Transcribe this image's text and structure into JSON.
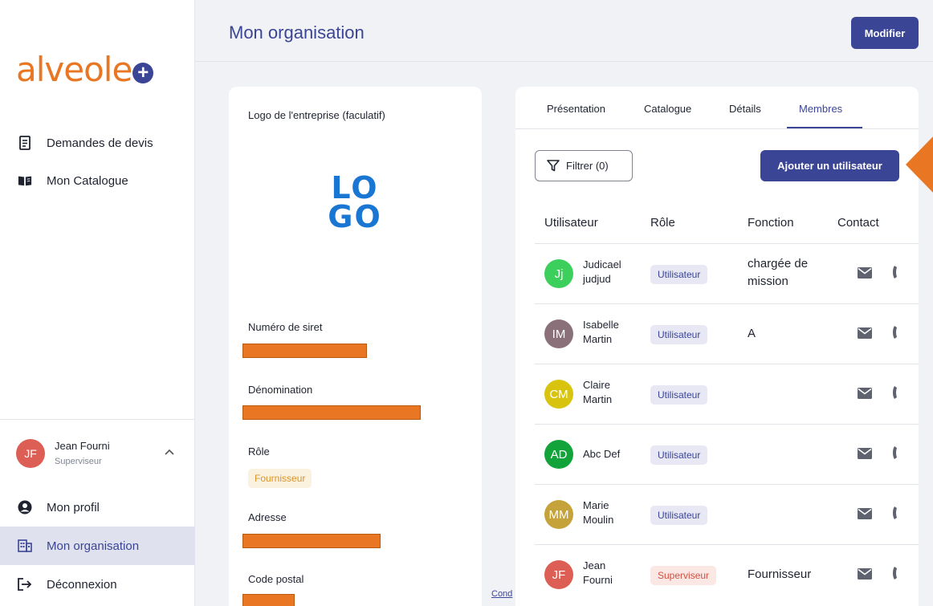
{
  "brand": {
    "logo_text": "alveole",
    "logo_plus": "+"
  },
  "sidebar": {
    "items": [
      {
        "label": "Demandes de devis",
        "icon": "document-list-icon"
      },
      {
        "label": "Mon Catalogue",
        "icon": "book-icon"
      }
    ],
    "user": {
      "initials": "JF",
      "name": "Jean Fourni",
      "role": "Superviseur"
    },
    "bottom_items": [
      {
        "label": "Mon profil",
        "icon": "account-circle-icon"
      },
      {
        "label": "Mon organisation",
        "icon": "building-icon",
        "active": true
      },
      {
        "label": "Déconnexion",
        "icon": "logout-icon"
      }
    ]
  },
  "header": {
    "title": "Mon organisation",
    "modify_label": "Modifier"
  },
  "org": {
    "logo_label": "Logo de l'entreprise (faculatif)",
    "logo_image_text": [
      "LO",
      "GO"
    ],
    "siret_label": "Numéro de siret",
    "denomination_label": "Dénomination",
    "role_label": "Rôle",
    "role_value": "Fournisseur",
    "adresse_label": "Adresse",
    "code_postal_label": "Code postal"
  },
  "footer": {
    "link_text": "Cond"
  },
  "tabs": [
    {
      "label": "Présentation"
    },
    {
      "label": "Catalogue"
    },
    {
      "label": "Détails"
    },
    {
      "label": "Membres",
      "active": true
    }
  ],
  "members": {
    "filter_label": "Filtrer (0)",
    "add_label": "Ajouter un utilisateur",
    "columns": [
      "Utilisateur",
      "Rôle",
      "Fonction",
      "Contact"
    ],
    "rows": [
      {
        "initials": "Jj",
        "first": "Judicael",
        "last": "judjud",
        "role": "Utilisateur",
        "fonction": [
          "chargée de",
          "mission"
        ],
        "color": "#3ccf5c"
      },
      {
        "initials": "IM",
        "first": "Isabelle",
        "last": "Martin",
        "role": "Utilisateur",
        "fonction": [
          "A",
          ""
        ],
        "color": "#8a7078"
      },
      {
        "initials": "CM",
        "first": "Claire",
        "last": "Martin",
        "role": "Utilisateur",
        "fonction": [
          "",
          ""
        ],
        "color": "#d8c40f"
      },
      {
        "initials": "AD",
        "first": "Abc Def",
        "last": "",
        "role": "Utilisateur",
        "fonction": [
          "",
          ""
        ],
        "color": "#12a33b"
      },
      {
        "initials": "MM",
        "first": "Marie",
        "last": "Moulin",
        "role": "Utilisateur",
        "fonction": [
          "",
          ""
        ],
        "color": "#c6a23a"
      },
      {
        "initials": "JF",
        "first": "Jean",
        "last": "Fourni",
        "role": "Superviseur",
        "fonction": [
          "Fournisseur",
          ""
        ],
        "color": "#dc5e55"
      }
    ]
  },
  "colors": {
    "primary": "#3b4596",
    "accent": "#e97622"
  }
}
